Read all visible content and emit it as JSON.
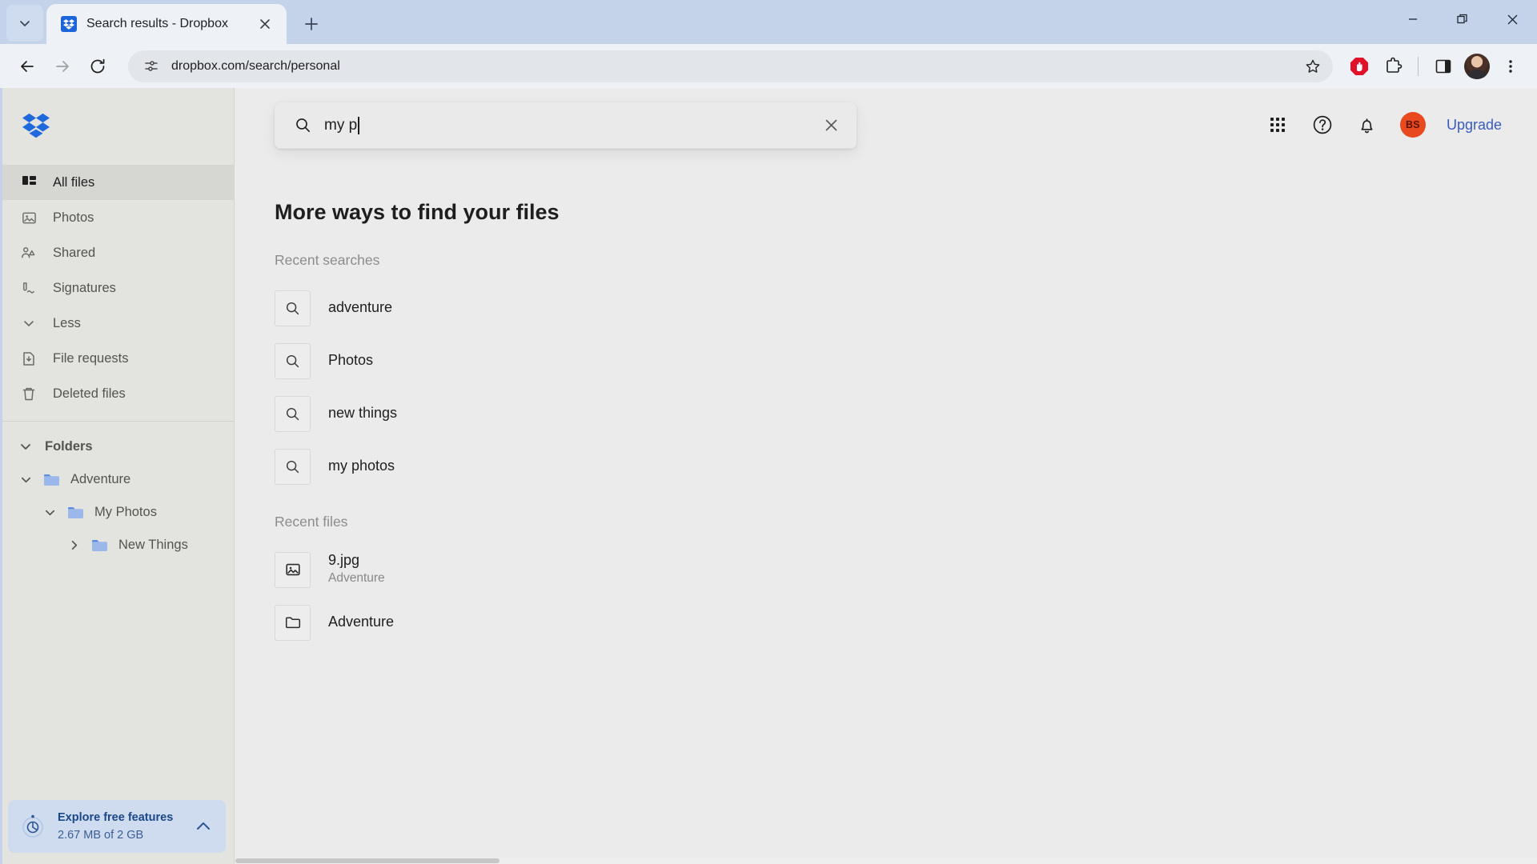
{
  "browser": {
    "tab": {
      "title": "Search results - Dropbox",
      "favicon_name": "dropbox-favicon",
      "close_label": "×"
    },
    "new_tab_label": "+",
    "tab_list_label": "⌄",
    "nav": {
      "back_label": "←",
      "forward_label": "→",
      "reload_label": "↻"
    },
    "omnibox": {
      "url": "dropbox.com/search/personal",
      "site_info_icon": "site-settings-icon",
      "star_icon": "bookmark-star-icon"
    },
    "toolbar_icons": [
      {
        "name": "adblock-icon",
        "label": "AdBlock"
      },
      {
        "name": "extensions-icon",
        "label": "Extensions"
      },
      {
        "name": "side-panel-icon",
        "label": "Side panel"
      },
      {
        "name": "profile-avatar",
        "label": "Profile"
      },
      {
        "name": "chrome-menu-icon",
        "label": "Customize and control"
      }
    ],
    "window_controls": {
      "minimize": "—",
      "maximize": "❐",
      "close": "✕"
    }
  },
  "sidebar": {
    "logo_name": "dropbox-logo",
    "nav_items": [
      {
        "label": "All files",
        "icon": "all-files-icon",
        "active": true
      },
      {
        "label": "Photos",
        "icon": "photos-icon",
        "active": false
      },
      {
        "label": "Shared",
        "icon": "shared-icon",
        "active": false
      },
      {
        "label": "Signatures",
        "icon": "signatures-icon",
        "active": false
      },
      {
        "label": "Less",
        "icon": "chevron-down-icon",
        "active": false
      },
      {
        "label": "File requests",
        "icon": "file-requests-icon",
        "active": false
      },
      {
        "label": "Deleted files",
        "icon": "trash-icon",
        "active": false
      }
    ],
    "folders_header": "Folders",
    "tree": [
      {
        "label": "Adventure",
        "depth": 0,
        "expanded": true
      },
      {
        "label": "My Photos",
        "depth": 1,
        "expanded": true
      },
      {
        "label": "New Things",
        "depth": 2,
        "expanded": false
      }
    ],
    "storage": {
      "title": "Explore free features",
      "subtitle": "2.67 MB of 2 GB",
      "icon": "storage-clock-icon",
      "collapse_icon": "chevron-up-icon"
    }
  },
  "header": {
    "search": {
      "value": "my p",
      "placeholder": "Search",
      "search_icon": "search-icon",
      "clear_label": "✕"
    },
    "apps_icon": "grid-apps-icon",
    "help_icon": "help-circle-icon",
    "notifications_icon": "bell-icon",
    "avatar_initials": "BS",
    "upgrade_label": "Upgrade",
    "accent_blue": "#3b5bbf",
    "avatar_bg": "#e8491f"
  },
  "main": {
    "title": "More ways to find your files",
    "sections": [
      {
        "label": "Recent searches",
        "items": [
          {
            "title": "adventure",
            "subtitle": "",
            "icon": "search-icon"
          },
          {
            "title": "Photos",
            "subtitle": "",
            "icon": "search-icon"
          },
          {
            "title": "new things",
            "subtitle": "",
            "icon": "search-icon"
          },
          {
            "title": "my photos",
            "subtitle": "",
            "icon": "search-icon"
          }
        ]
      },
      {
        "label": "Recent files",
        "items": [
          {
            "title": "9.jpg",
            "subtitle": "Adventure",
            "icon": "image-file-icon"
          },
          {
            "title": "Adventure",
            "subtitle": "",
            "icon": "folder-icon"
          }
        ]
      }
    ]
  }
}
